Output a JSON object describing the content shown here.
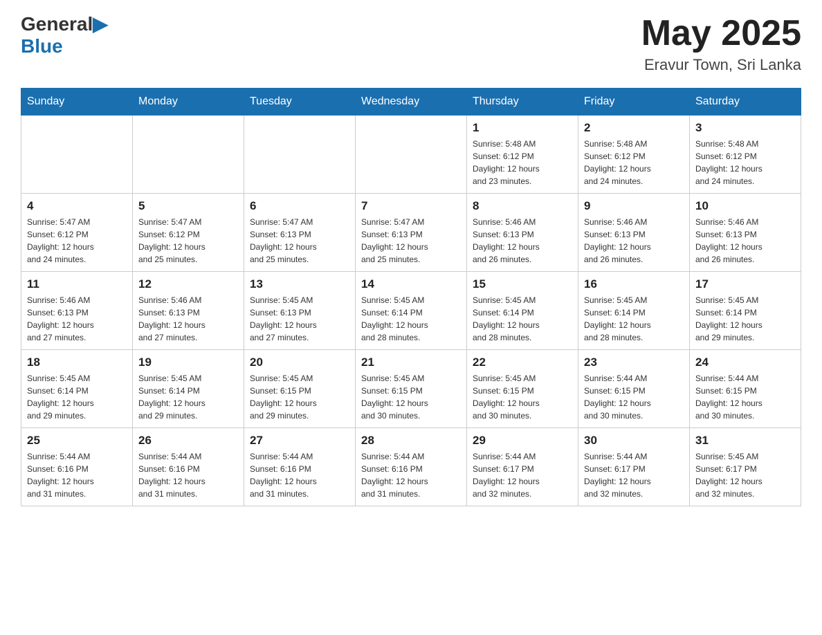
{
  "header": {
    "logo_text_general": "General",
    "logo_text_blue": "Blue",
    "month": "May 2025",
    "location": "Eravur Town, Sri Lanka"
  },
  "days_of_week": [
    "Sunday",
    "Monday",
    "Tuesday",
    "Wednesday",
    "Thursday",
    "Friday",
    "Saturday"
  ],
  "weeks": [
    [
      {
        "day": "",
        "info": ""
      },
      {
        "day": "",
        "info": ""
      },
      {
        "day": "",
        "info": ""
      },
      {
        "day": "",
        "info": ""
      },
      {
        "day": "1",
        "info": "Sunrise: 5:48 AM\nSunset: 6:12 PM\nDaylight: 12 hours\nand 23 minutes."
      },
      {
        "day": "2",
        "info": "Sunrise: 5:48 AM\nSunset: 6:12 PM\nDaylight: 12 hours\nand 24 minutes."
      },
      {
        "day": "3",
        "info": "Sunrise: 5:48 AM\nSunset: 6:12 PM\nDaylight: 12 hours\nand 24 minutes."
      }
    ],
    [
      {
        "day": "4",
        "info": "Sunrise: 5:47 AM\nSunset: 6:12 PM\nDaylight: 12 hours\nand 24 minutes."
      },
      {
        "day": "5",
        "info": "Sunrise: 5:47 AM\nSunset: 6:12 PM\nDaylight: 12 hours\nand 25 minutes."
      },
      {
        "day": "6",
        "info": "Sunrise: 5:47 AM\nSunset: 6:13 PM\nDaylight: 12 hours\nand 25 minutes."
      },
      {
        "day": "7",
        "info": "Sunrise: 5:47 AM\nSunset: 6:13 PM\nDaylight: 12 hours\nand 25 minutes."
      },
      {
        "day": "8",
        "info": "Sunrise: 5:46 AM\nSunset: 6:13 PM\nDaylight: 12 hours\nand 26 minutes."
      },
      {
        "day": "9",
        "info": "Sunrise: 5:46 AM\nSunset: 6:13 PM\nDaylight: 12 hours\nand 26 minutes."
      },
      {
        "day": "10",
        "info": "Sunrise: 5:46 AM\nSunset: 6:13 PM\nDaylight: 12 hours\nand 26 minutes."
      }
    ],
    [
      {
        "day": "11",
        "info": "Sunrise: 5:46 AM\nSunset: 6:13 PM\nDaylight: 12 hours\nand 27 minutes."
      },
      {
        "day": "12",
        "info": "Sunrise: 5:46 AM\nSunset: 6:13 PM\nDaylight: 12 hours\nand 27 minutes."
      },
      {
        "day": "13",
        "info": "Sunrise: 5:45 AM\nSunset: 6:13 PM\nDaylight: 12 hours\nand 27 minutes."
      },
      {
        "day": "14",
        "info": "Sunrise: 5:45 AM\nSunset: 6:14 PM\nDaylight: 12 hours\nand 28 minutes."
      },
      {
        "day": "15",
        "info": "Sunrise: 5:45 AM\nSunset: 6:14 PM\nDaylight: 12 hours\nand 28 minutes."
      },
      {
        "day": "16",
        "info": "Sunrise: 5:45 AM\nSunset: 6:14 PM\nDaylight: 12 hours\nand 28 minutes."
      },
      {
        "day": "17",
        "info": "Sunrise: 5:45 AM\nSunset: 6:14 PM\nDaylight: 12 hours\nand 29 minutes."
      }
    ],
    [
      {
        "day": "18",
        "info": "Sunrise: 5:45 AM\nSunset: 6:14 PM\nDaylight: 12 hours\nand 29 minutes."
      },
      {
        "day": "19",
        "info": "Sunrise: 5:45 AM\nSunset: 6:14 PM\nDaylight: 12 hours\nand 29 minutes."
      },
      {
        "day": "20",
        "info": "Sunrise: 5:45 AM\nSunset: 6:15 PM\nDaylight: 12 hours\nand 29 minutes."
      },
      {
        "day": "21",
        "info": "Sunrise: 5:45 AM\nSunset: 6:15 PM\nDaylight: 12 hours\nand 30 minutes."
      },
      {
        "day": "22",
        "info": "Sunrise: 5:45 AM\nSunset: 6:15 PM\nDaylight: 12 hours\nand 30 minutes."
      },
      {
        "day": "23",
        "info": "Sunrise: 5:44 AM\nSunset: 6:15 PM\nDaylight: 12 hours\nand 30 minutes."
      },
      {
        "day": "24",
        "info": "Sunrise: 5:44 AM\nSunset: 6:15 PM\nDaylight: 12 hours\nand 30 minutes."
      }
    ],
    [
      {
        "day": "25",
        "info": "Sunrise: 5:44 AM\nSunset: 6:16 PM\nDaylight: 12 hours\nand 31 minutes."
      },
      {
        "day": "26",
        "info": "Sunrise: 5:44 AM\nSunset: 6:16 PM\nDaylight: 12 hours\nand 31 minutes."
      },
      {
        "day": "27",
        "info": "Sunrise: 5:44 AM\nSunset: 6:16 PM\nDaylight: 12 hours\nand 31 minutes."
      },
      {
        "day": "28",
        "info": "Sunrise: 5:44 AM\nSunset: 6:16 PM\nDaylight: 12 hours\nand 31 minutes."
      },
      {
        "day": "29",
        "info": "Sunrise: 5:44 AM\nSunset: 6:17 PM\nDaylight: 12 hours\nand 32 minutes."
      },
      {
        "day": "30",
        "info": "Sunrise: 5:44 AM\nSunset: 6:17 PM\nDaylight: 12 hours\nand 32 minutes."
      },
      {
        "day": "31",
        "info": "Sunrise: 5:45 AM\nSunset: 6:17 PM\nDaylight: 12 hours\nand 32 minutes."
      }
    ]
  ]
}
